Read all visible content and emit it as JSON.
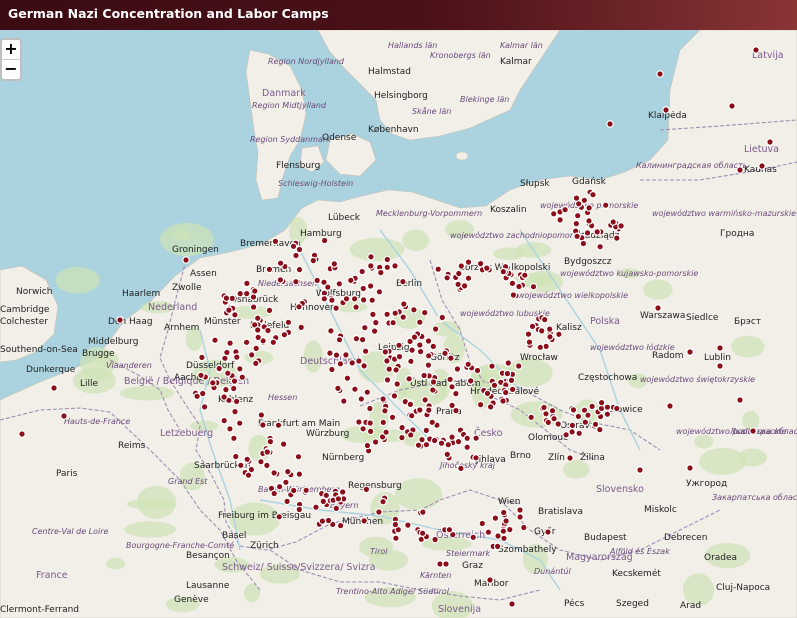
{
  "title": "German Nazi Concentration and Labor Camps",
  "zoom": {
    "in_label": "+",
    "out_label": "−"
  },
  "colors": {
    "marker_fill": "#8b0f1b",
    "marker_stroke": "#ffffff",
    "land": "#f2efe9",
    "water": "#aad3df",
    "border": "#9e8fb0"
  },
  "labels": [
    {
      "name": "Danmark",
      "kind": "country"
    },
    {
      "name": "Region Nordjylland",
      "kind": "region"
    },
    {
      "name": "Region Midtjylland",
      "kind": "region"
    },
    {
      "name": "Region Syddanmark",
      "kind": "region"
    },
    {
      "name": "Hallands län",
      "kind": "region"
    },
    {
      "name": "Kronobergs län",
      "kind": "region"
    },
    {
      "name": "Kalmar län",
      "kind": "region"
    },
    {
      "name": "Halmstad",
      "kind": "city"
    },
    {
      "name": "Kalmar",
      "kind": "city"
    },
    {
      "name": "Helsingborg",
      "kind": "city"
    },
    {
      "name": "København",
      "kind": "city"
    },
    {
      "name": "Skåne län",
      "kind": "region"
    },
    {
      "name": "Blekinge län",
      "kind": "region"
    },
    {
      "name": "Odense",
      "kind": "city"
    },
    {
      "name": "Latvija",
      "kind": "country"
    },
    {
      "name": "Klaipėda",
      "kind": "city"
    },
    {
      "name": "Lietuva",
      "kind": "country"
    },
    {
      "name": "Kaunas",
      "kind": "city"
    },
    {
      "name": "Flensburg",
      "kind": "city"
    },
    {
      "name": "Schleswig-Holstein",
      "kind": "region"
    },
    {
      "name": "Lübeck",
      "kind": "city"
    },
    {
      "name": "Mecklenburg-Vorpommern",
      "kind": "region"
    },
    {
      "name": "Koszalin",
      "kind": "city"
    },
    {
      "name": "Słupsk",
      "kind": "city"
    },
    {
      "name": "Gdańsk",
      "kind": "city"
    },
    {
      "name": "Калининградская область",
      "kind": "region"
    },
    {
      "name": "województwo pomorskie",
      "kind": "region"
    },
    {
      "name": "województwo warmińsko-mazurskie",
      "kind": "region"
    },
    {
      "name": "Grudziądz",
      "kind": "city"
    },
    {
      "name": "Гродна",
      "kind": "city"
    },
    {
      "name": "Groningen",
      "kind": "city"
    },
    {
      "name": "Bremerhaven",
      "kind": "city"
    },
    {
      "name": "Hamburg",
      "kind": "city"
    },
    {
      "name": "województwo zachodniopomorskie",
      "kind": "region"
    },
    {
      "name": "Assen",
      "kind": "city"
    },
    {
      "name": "Bremen",
      "kind": "city"
    },
    {
      "name": "Gorzów Wielkopolski",
      "kind": "city"
    },
    {
      "name": "Bydgoszcz",
      "kind": "city"
    },
    {
      "name": "województwo kujawsko-pomorskie",
      "kind": "region"
    },
    {
      "name": "Norwich",
      "kind": "city"
    },
    {
      "name": "Haarlem",
      "kind": "city"
    },
    {
      "name": "Zwolle",
      "kind": "city"
    },
    {
      "name": "Niedersachsen",
      "kind": "region"
    },
    {
      "name": "Berlin",
      "kind": "city"
    },
    {
      "name": "województwo wielkopolskie",
      "kind": "region"
    },
    {
      "name": "Cambridge",
      "kind": "city"
    },
    {
      "name": "Nederland",
      "kind": "country"
    },
    {
      "name": "Osnabrück",
      "kind": "city"
    },
    {
      "name": "Hannover",
      "kind": "city"
    },
    {
      "name": "Wolfsburg",
      "kind": "city"
    },
    {
      "name": "Colchester",
      "kind": "city"
    },
    {
      "name": "Den Haag",
      "kind": "city"
    },
    {
      "name": "Arnhem",
      "kind": "city"
    },
    {
      "name": "Münster",
      "kind": "city"
    },
    {
      "name": "Bielefeld",
      "kind": "city"
    },
    {
      "name": "województwo lubuskie",
      "kind": "region"
    },
    {
      "name": "Kalisz",
      "kind": "city"
    },
    {
      "name": "Polska",
      "kind": "country"
    },
    {
      "name": "Warszawa",
      "kind": "city"
    },
    {
      "name": "Siedlce",
      "kind": "city"
    },
    {
      "name": "Брэст",
      "kind": "city"
    },
    {
      "name": "Middelburg",
      "kind": "city"
    },
    {
      "name": "Leipzig",
      "kind": "city"
    },
    {
      "name": "Southend-on-Sea",
      "kind": "city"
    },
    {
      "name": "Brugge",
      "kind": "city"
    },
    {
      "name": "Deutschland",
      "kind": "country"
    },
    {
      "name": "Görlitz",
      "kind": "city"
    },
    {
      "name": "Wrocław",
      "kind": "city"
    },
    {
      "name": "województwo łódzkie",
      "kind": "region"
    },
    {
      "name": "Radom",
      "kind": "city"
    },
    {
      "name": "Lublin",
      "kind": "city"
    },
    {
      "name": "Dunkerque",
      "kind": "city"
    },
    {
      "name": "Vlaanderen",
      "kind": "region"
    },
    {
      "name": "Düsseldorf",
      "kind": "city"
    },
    {
      "name": "Częstochowa",
      "kind": "city"
    },
    {
      "name": "Lille",
      "kind": "city"
    },
    {
      "name": "België / Belgique / Belgien",
      "kind": "country"
    },
    {
      "name": "Aachen",
      "kind": "city"
    },
    {
      "name": "Ústí nad Labem",
      "kind": "city"
    },
    {
      "name": "Hradec Králové",
      "kind": "city"
    },
    {
      "name": "województwo świętokrzyskie",
      "kind": "region"
    },
    {
      "name": "Koblenz",
      "kind": "city"
    },
    {
      "name": "Hessen",
      "kind": "region"
    },
    {
      "name": "Katowice",
      "kind": "city"
    },
    {
      "name": "Praha",
      "kind": "city"
    },
    {
      "name": "Ostrava",
      "kind": "city"
    },
    {
      "name": "Frankfurt am Main",
      "kind": "city"
    },
    {
      "name": "Hauts-de-France",
      "kind": "region"
    },
    {
      "name": "Letzebuerg",
      "kind": "country"
    },
    {
      "name": "Würzburg",
      "kind": "city"
    },
    {
      "name": "Česko",
      "kind": "country"
    },
    {
      "name": "Olomouc",
      "kind": "city"
    },
    {
      "name": "województwo podkarpackie",
      "kind": "region"
    },
    {
      "name": "Львівська область",
      "kind": "region"
    },
    {
      "name": "Reims",
      "kind": "city"
    },
    {
      "name": "Nürnberg",
      "kind": "city"
    },
    {
      "name": "Brno",
      "kind": "city"
    },
    {
      "name": "Zlín",
      "kind": "city"
    },
    {
      "name": "Žilina",
      "kind": "city"
    },
    {
      "name": "Paris",
      "kind": "city"
    },
    {
      "name": "Saarbrücken",
      "kind": "city"
    },
    {
      "name": "Jihlava",
      "kind": "city"
    },
    {
      "name": "Jihočeský kraj",
      "kind": "region"
    },
    {
      "name": "Slovensko",
      "kind": "country"
    },
    {
      "name": "Ужгород",
      "kind": "city"
    },
    {
      "name": "Закарпатська область",
      "kind": "region"
    },
    {
      "name": "Grand Est",
      "kind": "region"
    },
    {
      "name": "Regensburg",
      "kind": "city"
    },
    {
      "name": "Baden-Württemberg",
      "kind": "region"
    },
    {
      "name": "Bayern",
      "kind": "region"
    },
    {
      "name": "Wien",
      "kind": "city"
    },
    {
      "name": "Bratislava",
      "kind": "city"
    },
    {
      "name": "Miskolc",
      "kind": "city"
    },
    {
      "name": "Freiburg im Breisgau",
      "kind": "city"
    },
    {
      "name": "München",
      "kind": "city"
    },
    {
      "name": "Győr",
      "kind": "city"
    },
    {
      "name": "Budapest",
      "kind": "city"
    },
    {
      "name": "Debrecen",
      "kind": "city"
    },
    {
      "name": "Centre-Val de Loire",
      "kind": "region"
    },
    {
      "name": "Basel",
      "kind": "city"
    },
    {
      "name": "Österreich",
      "kind": "country"
    },
    {
      "name": "Szombathely",
      "kind": "city"
    },
    {
      "name": "Zürich",
      "kind": "city"
    },
    {
      "name": "Bourgogne-Franche-Comté",
      "kind": "region"
    },
    {
      "name": "Steiermark",
      "kind": "region"
    },
    {
      "name": "Magyarország",
      "kind": "country"
    },
    {
      "name": "Alföld és Észak",
      "kind": "region"
    },
    {
      "name": "Oradea",
      "kind": "city"
    },
    {
      "name": "Besançon",
      "kind": "city"
    },
    {
      "name": "Schweiz/ Suisse/Svizzera/ Svizra",
      "kind": "country"
    },
    {
      "name": "Tirol",
      "kind": "region"
    },
    {
      "name": "Kärnten",
      "kind": "region"
    },
    {
      "name": "Graz",
      "kind": "city"
    },
    {
      "name": "Dunántúl",
      "kind": "region"
    },
    {
      "name": "Kecskemét",
      "kind": "city"
    },
    {
      "name": "France",
      "kind": "country"
    },
    {
      "name": "Lausanne",
      "kind": "city"
    },
    {
      "name": "Maribor",
      "kind": "city"
    },
    {
      "name": "Cluj-Napoca",
      "kind": "city"
    },
    {
      "name": "Clermont-Ferrand",
      "kind": "city"
    },
    {
      "name": "Genève",
      "kind": "city"
    },
    {
      "name": "Trentino-Alto Adige/ Südtirol",
      "kind": "region"
    },
    {
      "name": "Slovenija",
      "kind": "country"
    },
    {
      "name": "Pécs",
      "kind": "city"
    },
    {
      "name": "Szeged",
      "kind": "city"
    },
    {
      "name": "Arad",
      "kind": "city"
    }
  ],
  "camp_markers": {
    "count": 520,
    "description_visible": false
  }
}
